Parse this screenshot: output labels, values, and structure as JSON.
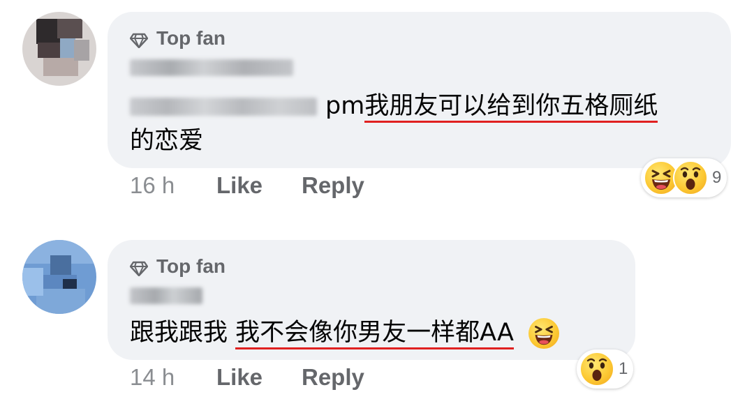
{
  "comments": [
    {
      "badge": "Top fan",
      "text_before": "pm",
      "text_underlined": "我朋友可以给到你五格厕纸",
      "text_line2": "的恋爱",
      "time": "16 h",
      "like": "Like",
      "reply": "Reply",
      "reactions": [
        "laughing-face",
        "wow-face"
      ],
      "reaction_count": "9"
    },
    {
      "badge": "Top fan",
      "text_before": "跟我跟我 ",
      "text_underlined": "我不会像你男友一样都AA",
      "emoji": "laughing-face",
      "time": "14 h",
      "like": "Like",
      "reply": "Reply",
      "reactions": [
        "wow-face"
      ],
      "reaction_count": "1"
    }
  ],
  "colors": {
    "bubble": "#f0f2f5",
    "meta_text": "#65676b",
    "underline": "#e02020",
    "body_text": "#050505"
  }
}
